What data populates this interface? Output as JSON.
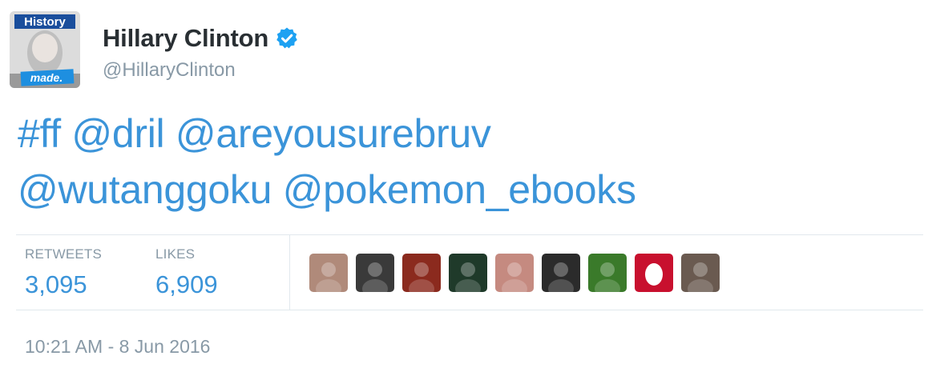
{
  "user": {
    "display_name": "Hillary Clinton",
    "handle": "@HillaryClinton",
    "verified": true,
    "avatar_badge_top": "History",
    "avatar_badge_bottom": "made."
  },
  "tweet": {
    "line1": [
      "#ff",
      "@dril",
      "@areyousurebruv"
    ],
    "line2": [
      "@wutanggoku",
      "@pokemon_ebooks"
    ]
  },
  "stats": {
    "retweets_label": "RETWEETS",
    "retweets_count": "3,095",
    "likes_label": "LIKES",
    "likes_count": "6,909"
  },
  "likers": [
    {
      "icon": "liker-avatar",
      "color": "#b08a7a"
    },
    {
      "icon": "liker-avatar",
      "color": "#3a3a3a"
    },
    {
      "icon": "liker-avatar",
      "color": "#8b2a1e"
    },
    {
      "icon": "liker-avatar",
      "color": "#1f3a2a"
    },
    {
      "icon": "liker-avatar",
      "color": "#c58a80"
    },
    {
      "icon": "liker-avatar",
      "color": "#2b2b2b"
    },
    {
      "icon": "liker-avatar",
      "color": "#3a7a2a"
    },
    {
      "icon": "egg-avatar",
      "color": "#c8102e"
    },
    {
      "icon": "liker-avatar",
      "color": "#6a5a50"
    }
  ],
  "timestamp": "10:21 AM - 8 Jun 2016",
  "colors": {
    "link": "#3b94d9",
    "muted": "#8899a6",
    "verified": "#1da1f2"
  }
}
